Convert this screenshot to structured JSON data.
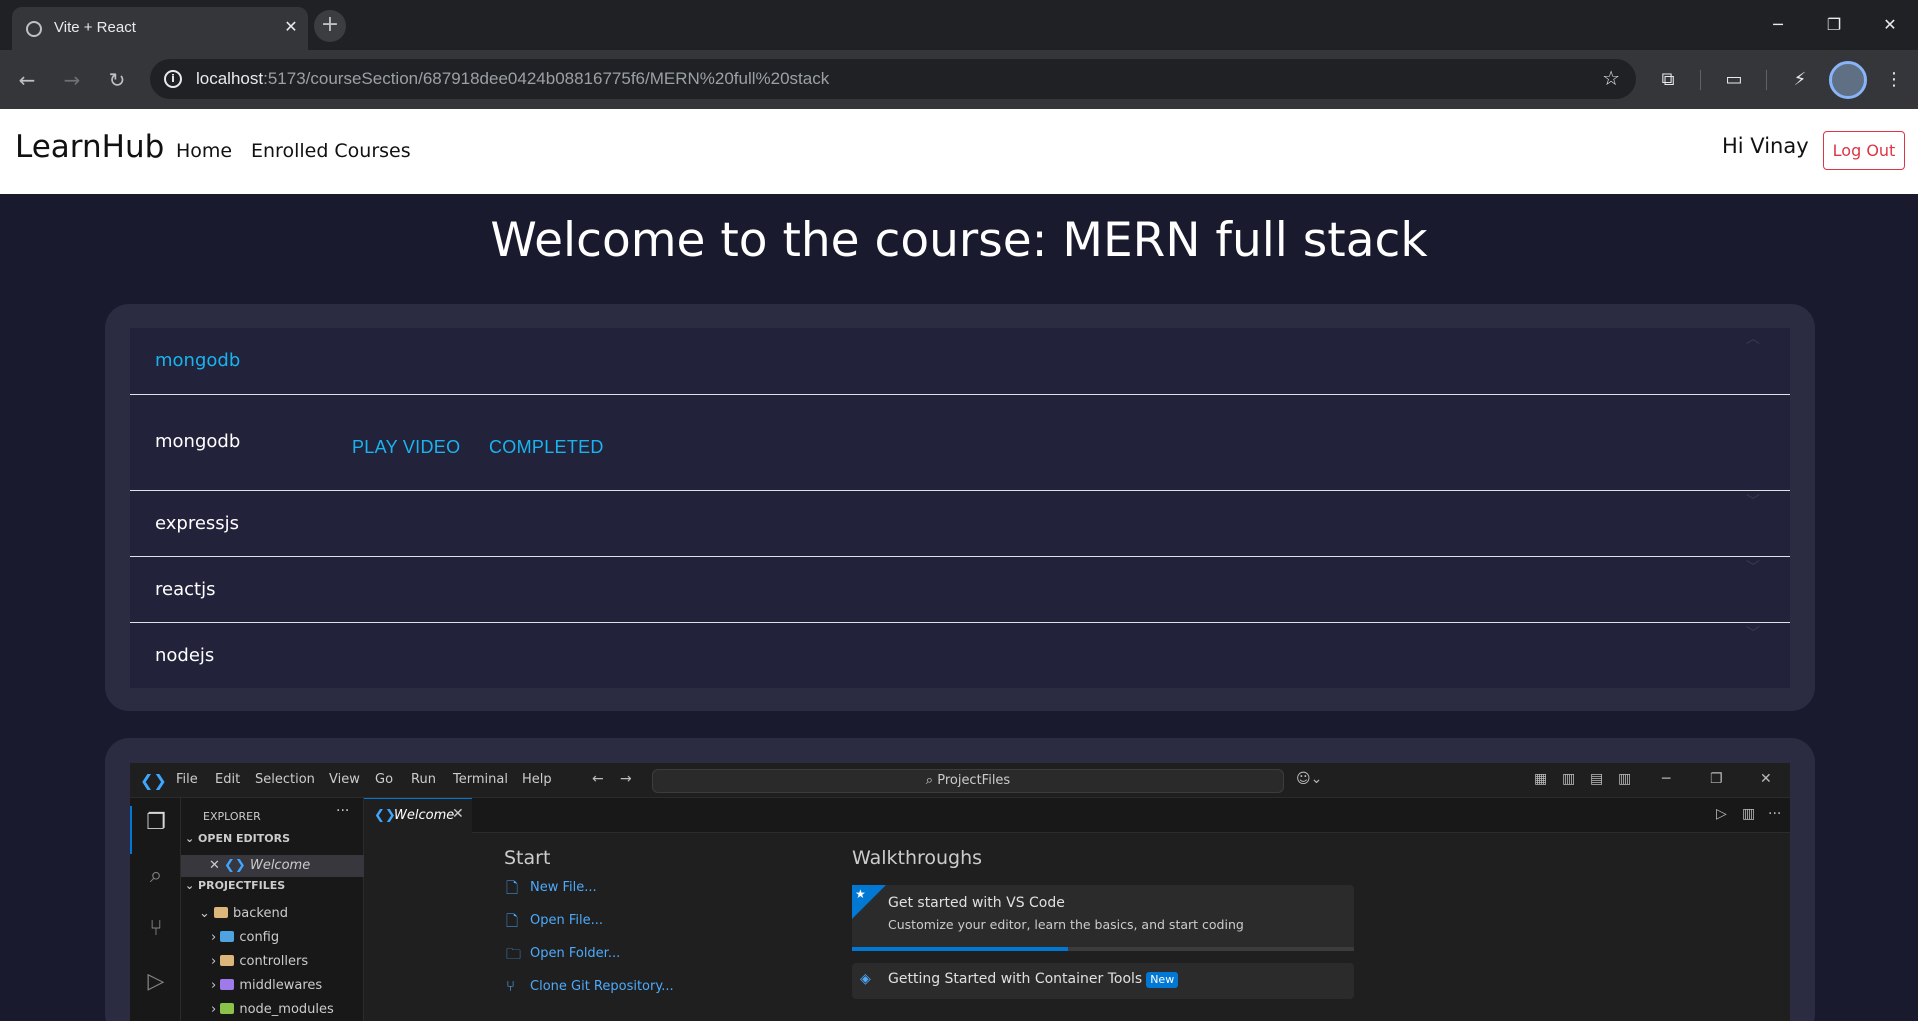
{
  "browser": {
    "tab_title": "Vite + React",
    "tab_close": "✕",
    "new_tab": "+",
    "url_host": "localhost",
    "url_rest": ":5173/courseSection/687918dee0424b08816775f6/MERN%20full%20stack",
    "window_controls": {
      "minimize": "─",
      "restore": "❐",
      "close": "✕"
    }
  },
  "header": {
    "brand": "LearnHub",
    "nav": {
      "home": "Home",
      "enrolled": "Enrolled Courses"
    },
    "greeting": "Hi Vinay",
    "logout_label": "Log Out"
  },
  "course": {
    "title": "Welcome to the course: MERN full stack",
    "sections": [
      {
        "title": "mongodb",
        "expanded": true
      },
      {
        "title": "expressjs",
        "expanded": false
      },
      {
        "title": "reactjs",
        "expanded": false
      },
      {
        "title": "nodejs",
        "expanded": false
      }
    ],
    "lesson": {
      "name": "mongodb",
      "play_label": "PLAY VIDEO",
      "status_label": "COMPLETED"
    }
  },
  "video": {
    "menu": [
      "File",
      "Edit",
      "Selection",
      "View",
      "Go",
      "Run",
      "Terminal",
      "Help"
    ],
    "search": "ProjectFiles",
    "explorer_title": "EXPLORER",
    "explorer_more": "···",
    "open_editors": "OPEN EDITORS",
    "open_editor_item": "Welcome",
    "project": "PROJECTFILES",
    "tree": [
      "backend",
      "config",
      "controllers",
      "middlewares",
      "node_modules"
    ],
    "tab_label": "Welcome",
    "start_heading": "Start",
    "start_links": [
      "New File...",
      "Open File...",
      "Open Folder...",
      "Clone Git Repository..."
    ],
    "walkthroughs_heading": "Walkthroughs",
    "walk1_title": "Get started with VS Code",
    "walk1_desc": "Customize your editor, learn the basics, and start coding",
    "walk1_progress": 0.43,
    "walk2_title": "Getting Started with Container Tools",
    "walk2_badge": "New"
  },
  "colors": {
    "page_bg": "#1a1a2e",
    "accent": "#19b4f0",
    "logout": "#dc3545"
  }
}
